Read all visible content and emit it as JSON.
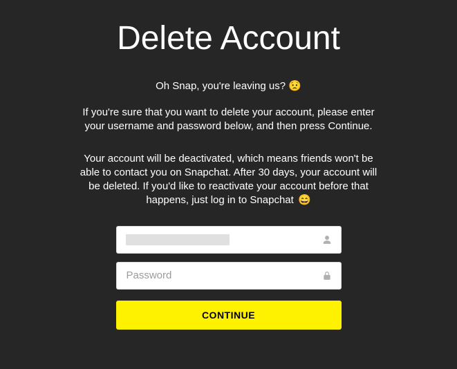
{
  "title": "Delete Account",
  "subtitle_text": "Oh Snap, you're leaving us? ",
  "subtitle_emoji": "😟",
  "paragraph1": "If you're sure that you want to delete your account, please enter your username and password below, and then press Continue.",
  "paragraph2_text": "Your account will be deactivated, which means friends won't be able to contact you on Snapchat. After 30 days, your account will be deleted. If you'd like to reactivate your account before that happens, just log in to Snapchat ",
  "paragraph2_emoji": "😄",
  "form": {
    "username": {
      "value": "",
      "placeholder": ""
    },
    "password": {
      "value": "",
      "placeholder": "Password"
    },
    "continue_label": "CONTINUE"
  }
}
